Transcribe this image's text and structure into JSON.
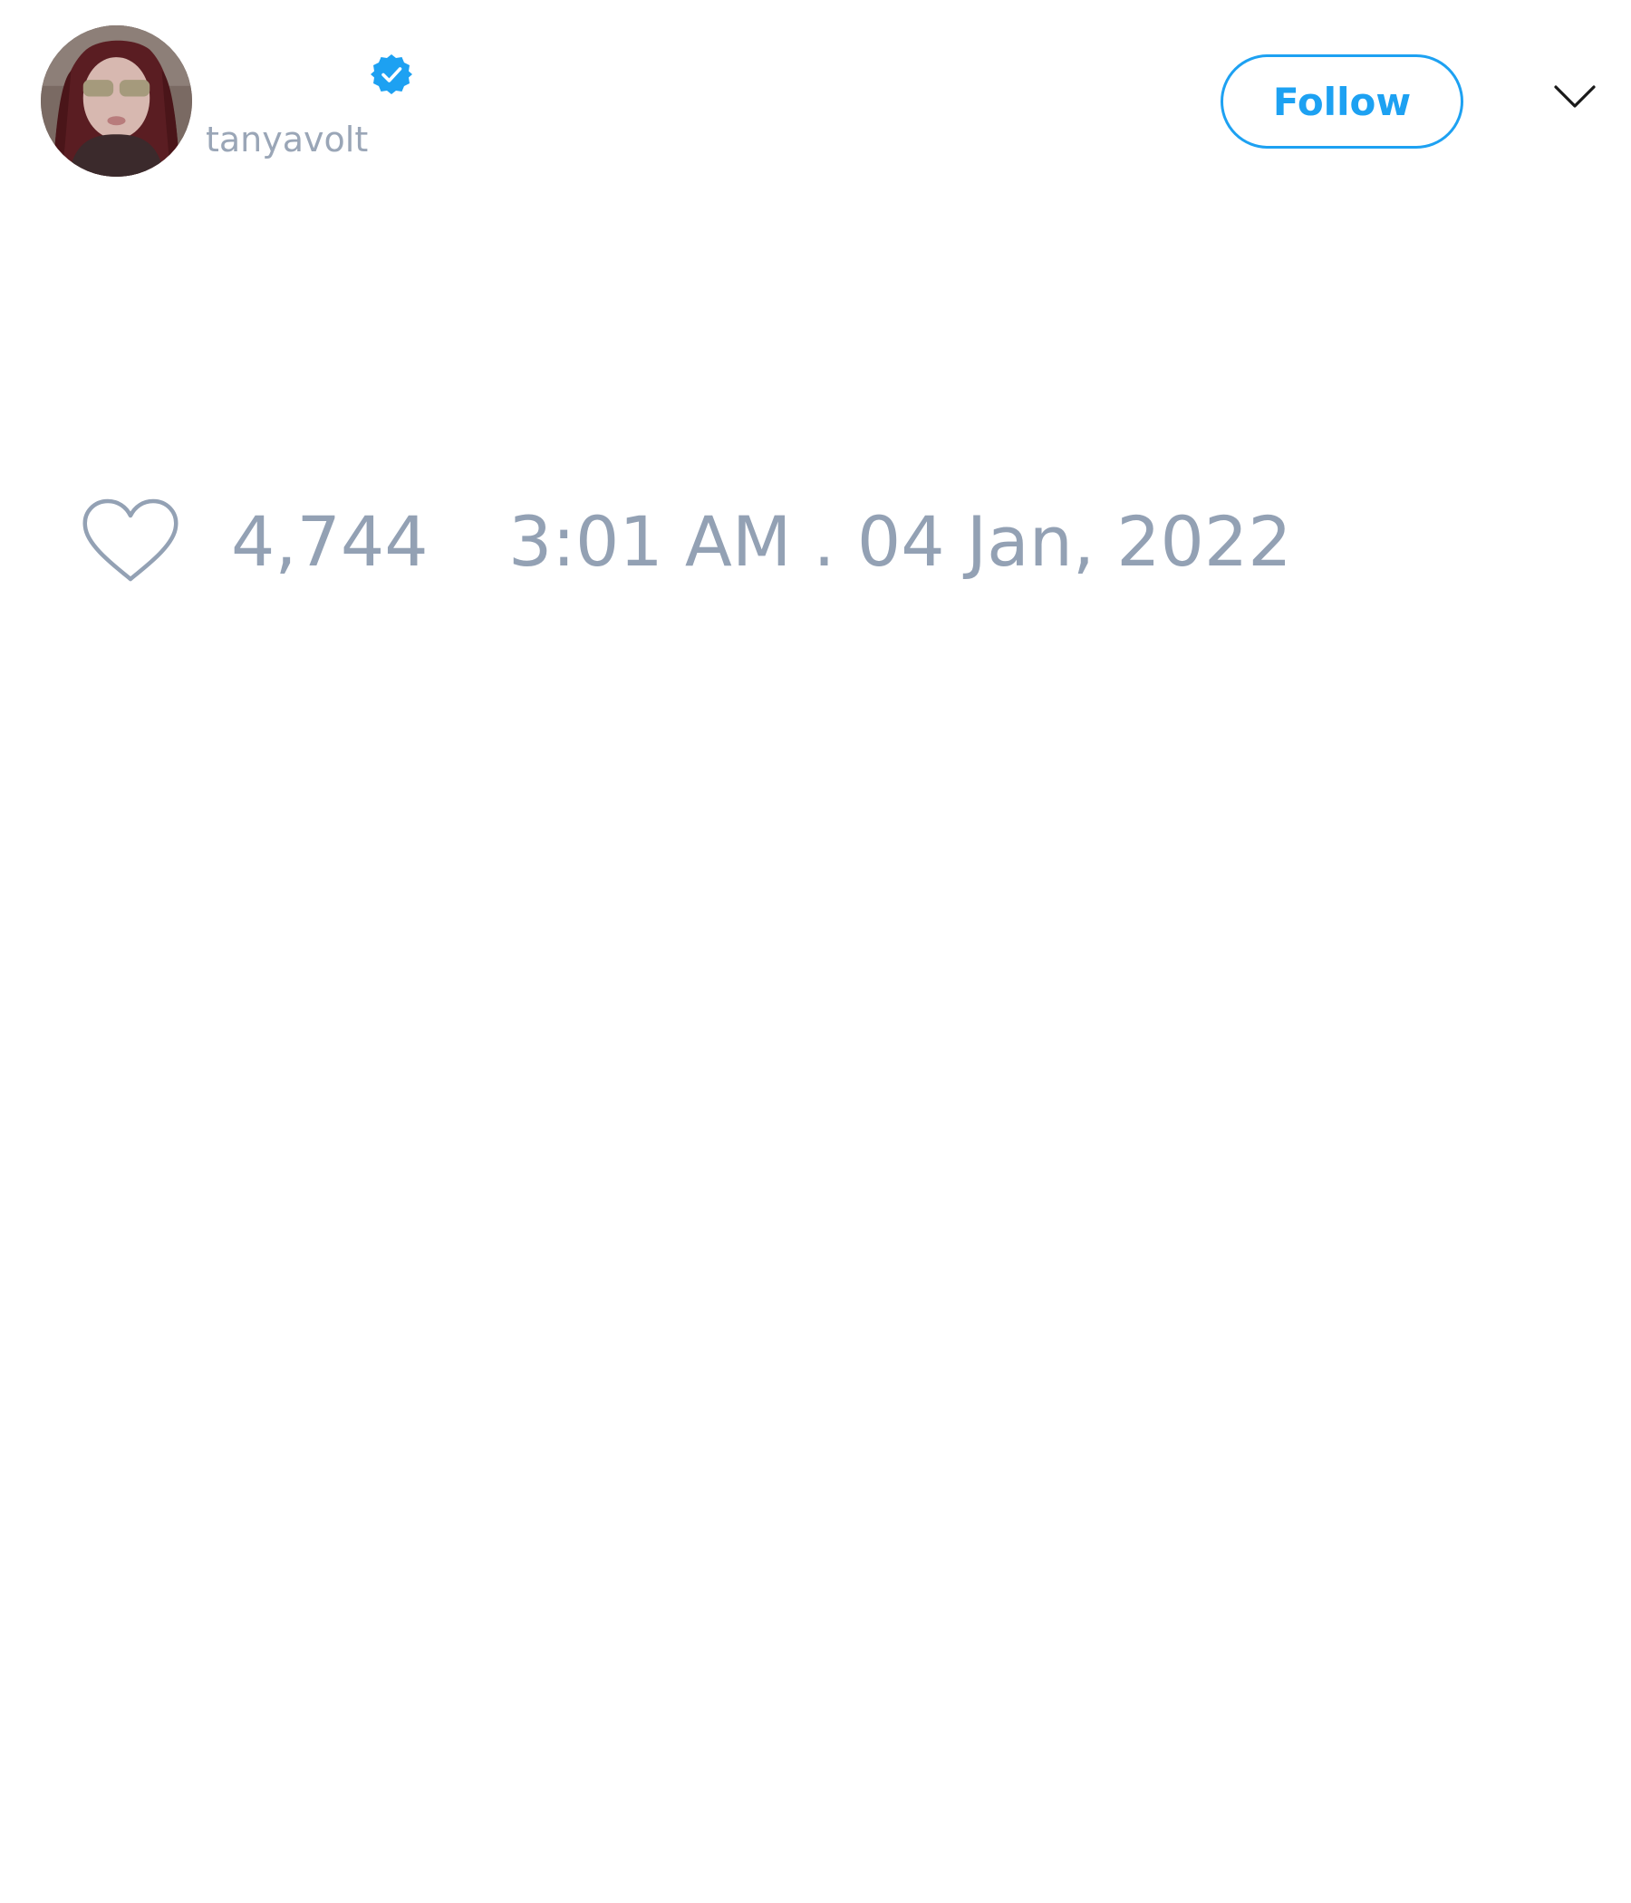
{
  "tweet": {
    "author": {
      "handle": "tanyavolt",
      "verified": true,
      "avatar_icon": "profile-photo"
    },
    "follow_label": "Follow",
    "menu_icon": "chevron-down-icon",
    "like_icon": "heart-outline-icon",
    "like_count": "4,744",
    "timestamp": "3:01 AM . 04 Jan, 2022"
  },
  "colors": {
    "accent": "#1da1f2",
    "muted_text": "#93a1b4",
    "background": "#ffffff"
  }
}
